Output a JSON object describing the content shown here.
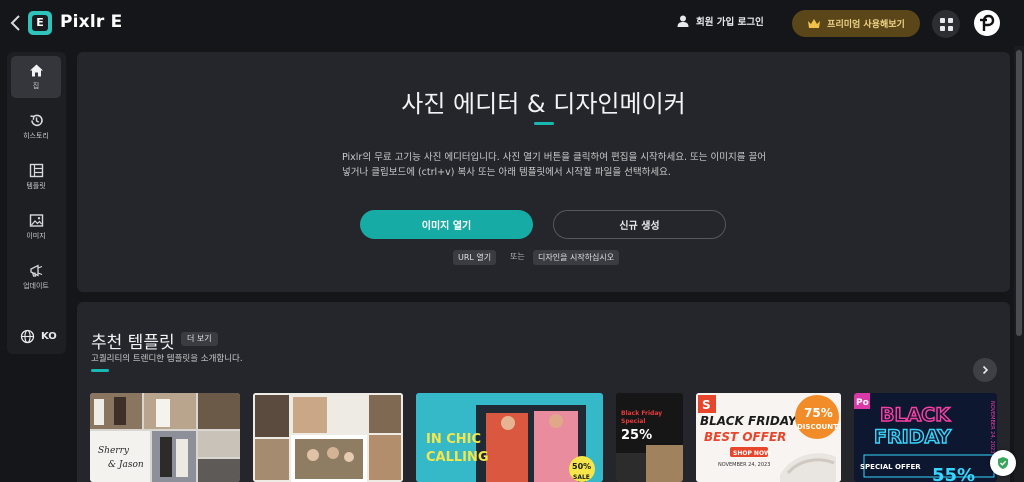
{
  "header": {
    "brand": "Pixlr E",
    "logo_letter": "E",
    "login_label": "회원 가입 로그인",
    "premium_label": "프리미엄 사용해보기"
  },
  "sidebar": {
    "items": [
      {
        "label": "집",
        "icon": "home-icon"
      },
      {
        "label": "히스토리",
        "icon": "history-icon"
      },
      {
        "label": "템플릿",
        "icon": "template-icon"
      },
      {
        "label": "이미지",
        "icon": "image-icon"
      },
      {
        "label": "업데이트",
        "icon": "megaphone-icon"
      }
    ],
    "language": "KO"
  },
  "hero": {
    "title": "사진 에디터 & 디자인메이커",
    "description": "Pixlr의 무료 고기능 사진 에디터입니다. 사진 열기 버튼을 클릭하여 편집을 시작하세요. 또는 이미지를 끌어 넣거나 클립보드에 (ctrl+v) 복사 또는 아래 템플릿에서 시작할 파일을 선택하세요.",
    "open_image": "이미지 열기",
    "create_new": "신규 생성",
    "url_open": "URL 열기",
    "or": "또는",
    "start_design": "디자인을 시작하십시오"
  },
  "templates": {
    "title": "추천 템플릿",
    "more": "더 보기",
    "subtitle": "고퀄리티의 트렌디한 템플릿을 소개합니다.",
    "cards": [
      {
        "text": [
          "Sherry",
          "& Jason"
        ]
      },
      {
        "text": []
      },
      {
        "text": [
          "IN CHIC",
          "CALLING",
          "50%",
          "SALE"
        ]
      },
      {
        "text": [
          "Black Friday",
          "Special",
          "25%"
        ]
      },
      {
        "text": [
          "BLACK FRIDAY",
          "BEST OFFER",
          "75%",
          "DISCOUNT",
          "SHOP NOW",
          "NOVEMBER 24, 2023",
          "S"
        ]
      },
      {
        "text": [
          "BLACK",
          "FRIDAY",
          "SPECIAL OFFER",
          "55%",
          "NOVEMBER 24, 2023",
          "Po"
        ]
      }
    ]
  },
  "colors": {
    "accent": "#16aca5",
    "background": "#151619",
    "panel": "#25262b",
    "premium": "#5a4618"
  }
}
